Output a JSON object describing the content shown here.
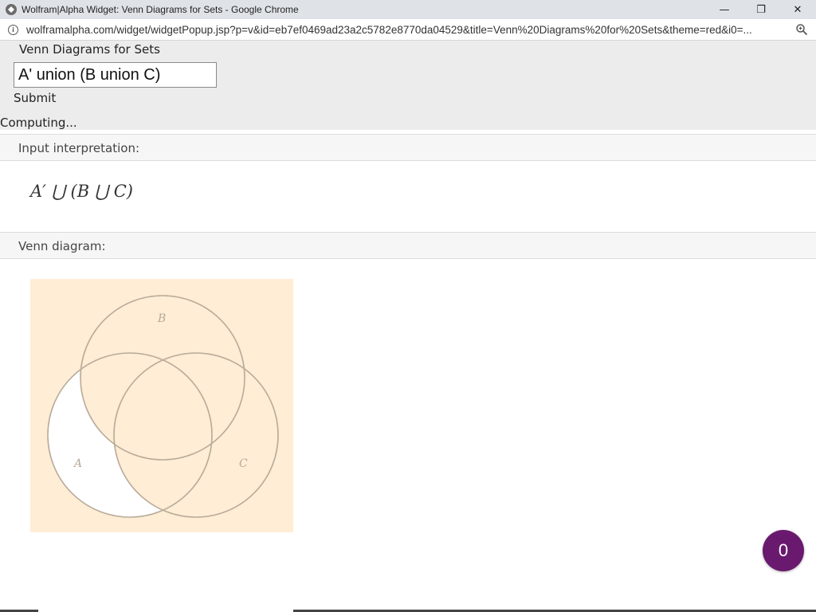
{
  "window": {
    "title": "Wolfram|Alpha Widget: Venn Diagrams for Sets - Google Chrome",
    "minimize_glyph": "—",
    "maximize_glyph": "❐",
    "close_glyph": "✕"
  },
  "address_bar": {
    "url": "wolframalpha.com/widget/widgetPopup.jsp?p=v&id=eb7ef0469ad23a2c5782e8770da04529&title=Venn%20Diagrams%20for%20Sets&theme=red&i0=..."
  },
  "widget": {
    "title": "Venn Diagrams for Sets",
    "input_value": "A' union (B union C)",
    "submit_label": "Submit",
    "status": "Computing..."
  },
  "pods": {
    "interpretation": {
      "header": "Input interpretation:",
      "expression": "A′ ⋃ (B ⋃ C)"
    },
    "venn": {
      "header": "Venn diagram:",
      "labels": {
        "a": "A",
        "b": "B",
        "c": "C"
      },
      "shaded_color": "#ffedd5",
      "unshaded_color": "#ffffff",
      "outline_color": "#b9ab9a"
    }
  },
  "fab": {
    "label": "0",
    "color": "#6a1a6e"
  }
}
